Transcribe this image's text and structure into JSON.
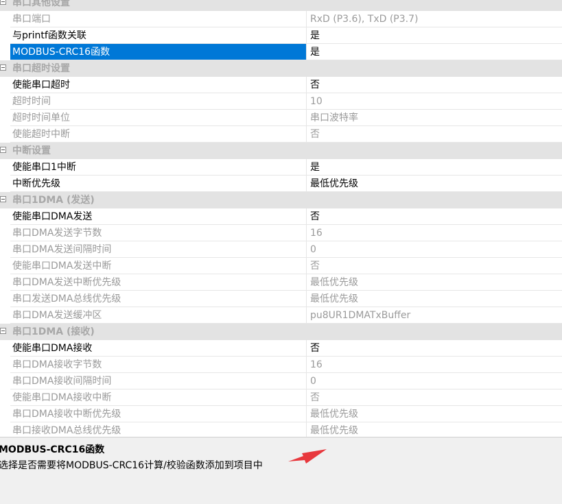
{
  "colors": {
    "selection": "#0078d7",
    "category_bg": "#e3e3e3",
    "category_text": "#a8a8a8",
    "disabled_text": "#9a9a9a",
    "annotation_arrow": "#e8383d"
  },
  "groups": [
    {
      "title": "串口其他设置",
      "rows": [
        {
          "name": "串口端口",
          "value": "RxD (P3.6), TxD (P3.7)",
          "enabled": false
        },
        {
          "name": "与printf函数关联",
          "value": "是",
          "enabled": true
        },
        {
          "name": "MODBUS-CRC16函数",
          "value": "是",
          "enabled": true,
          "selected": true
        }
      ]
    },
    {
      "title": "串口超时设置",
      "rows": [
        {
          "name": "使能串口超时",
          "value": "否",
          "enabled": true
        },
        {
          "name": "超时时间",
          "value": "10",
          "enabled": false
        },
        {
          "name": "超时时间单位",
          "value": "串口波特率",
          "enabled": false
        },
        {
          "name": "使能超时中断",
          "value": "否",
          "enabled": false
        }
      ]
    },
    {
      "title": "中断设置",
      "rows": [
        {
          "name": "使能串口1中断",
          "value": "是",
          "enabled": true
        },
        {
          "name": "中断优先级",
          "value": "最低优先级",
          "enabled": true
        }
      ]
    },
    {
      "title": "串口1DMA (发送)",
      "rows": [
        {
          "name": "使能串口DMA发送",
          "value": "否",
          "enabled": true
        },
        {
          "name": "串口DMA发送字节数",
          "value": "16",
          "enabled": false
        },
        {
          "name": "串口DMA发送间隔时间",
          "value": "0",
          "enabled": false
        },
        {
          "name": "使能串口DMA发送中断",
          "value": "否",
          "enabled": false
        },
        {
          "name": "串口DMA发送中断优先级",
          "value": "最低优先级",
          "enabled": false
        },
        {
          "name": "串口发送DMA总线优先级",
          "value": "最低优先级",
          "enabled": false
        },
        {
          "name": "串口DMA发送缓冲区",
          "value": "pu8UR1DMATxBuffer",
          "enabled": false
        }
      ]
    },
    {
      "title": "串口1DMA (接收)",
      "rows": [
        {
          "name": "使能串口DMA接收",
          "value": "否",
          "enabled": true
        },
        {
          "name": "串口DMA接收字节数",
          "value": "16",
          "enabled": false
        },
        {
          "name": "串口DMA接收间隔时间",
          "value": "0",
          "enabled": false
        },
        {
          "name": "使能串口DMA接收中断",
          "value": "否",
          "enabled": false
        },
        {
          "name": "串口DMA接收中断优先级",
          "value": "最低优先级",
          "enabled": false
        },
        {
          "name": "串口接收DMA总线优先级",
          "value": "最低优先级",
          "enabled": false
        }
      ]
    }
  ],
  "description": {
    "title": "MODBUS-CRC16函数",
    "text": "选择是否需要将MODBUS-CRC16计算/校验函数添加到项目中"
  }
}
